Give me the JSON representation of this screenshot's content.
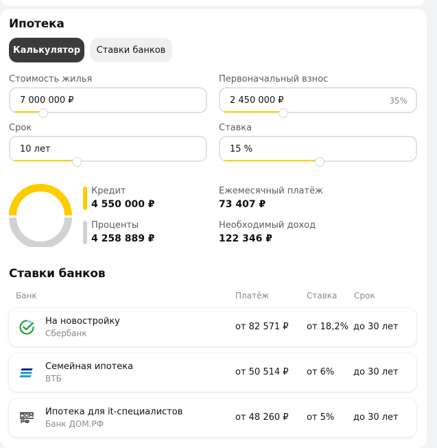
{
  "title": "Ипотека",
  "tabs": [
    {
      "label": "Калькулятор",
      "active": true
    },
    {
      "label": "Ставки банков",
      "active": false
    }
  ],
  "fields": {
    "price": {
      "label": "Стоимость жилья",
      "value": "7 000 000 ₽",
      "slider_fraction": 0.15
    },
    "down_payment": {
      "label": "Первоначальный взнос",
      "value": "2 450 000 ₽",
      "suffix": "35%",
      "slider_fraction": 0.31
    },
    "term": {
      "label": "Срок",
      "value": "10 лет",
      "slider_fraction": 0.33
    },
    "rate": {
      "label": "Ставка",
      "value": "15 %",
      "slider_fraction": 0.5
    }
  },
  "summary": {
    "credit_label": "Кредит",
    "credit_value": "4 550 000 ₽",
    "interest_label": "Проценты",
    "interest_value": "4 258 889 ₽",
    "monthly_label": "Ежемесячный платёж",
    "monthly_value": "73 407 ₽",
    "income_label": "Необходимый доход",
    "income_value": "122 346 ₽"
  },
  "colors": {
    "credit": "#ffcc00",
    "interest": "#d2d2d6",
    "accent": "#ffd400"
  },
  "rates_section": {
    "title": "Ставки банков",
    "headers": {
      "bank": "Банк",
      "payment": "Платёж",
      "rate": "Ставка",
      "term": "Срок"
    },
    "rows": [
      {
        "title": "На новостройку",
        "bank": "Сбербанк",
        "payment": "от 82 571 ₽",
        "rate": "от 18,2%",
        "term": "до 30 лет",
        "icon": "sberbank-logo-icon"
      },
      {
        "title": "Семейная ипотека",
        "bank": "ВТБ",
        "payment": "от 50 514 ₽",
        "rate": "от 6%",
        "term": "до 30 лет",
        "icon": "vtb-logo-icon"
      },
      {
        "title": "Ипотека для it-специалистов",
        "bank": "Банк ДОМ.РФ",
        "payment": "от 48 260 ₽",
        "rate": "от 5%",
        "term": "до 30 лет",
        "icon": "domrf-logo-icon"
      }
    ]
  }
}
